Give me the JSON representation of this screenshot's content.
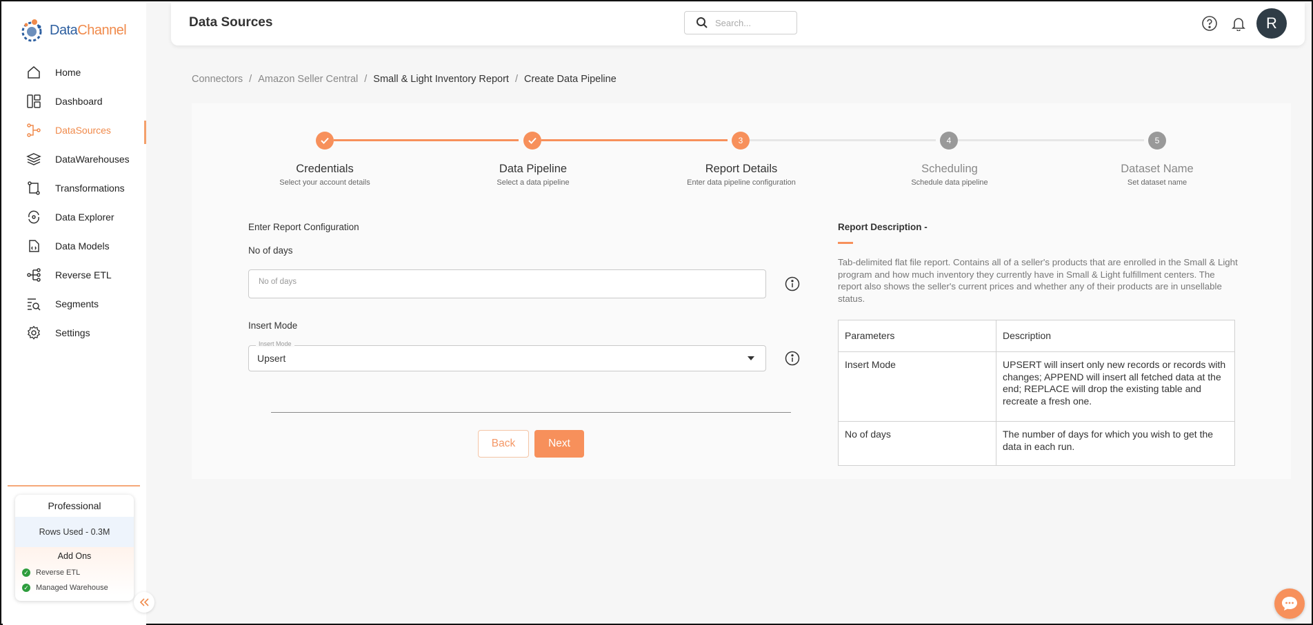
{
  "app": {
    "logo_text_a": "Data",
    "logo_text_b": "Channel",
    "accent_color": "#f7905b"
  },
  "sidebar": {
    "items": [
      {
        "label": "Home",
        "icon": "home-icon"
      },
      {
        "label": "Dashboard",
        "icon": "dashboard-icon"
      },
      {
        "label": "DataSources",
        "icon": "datasources-icon",
        "active": true
      },
      {
        "label": "DataWarehouses",
        "icon": "layers-icon"
      },
      {
        "label": "Transformations",
        "icon": "transform-icon"
      },
      {
        "label": "Data Explorer",
        "icon": "explorer-icon"
      },
      {
        "label": "Data Models",
        "icon": "data-models-icon"
      },
      {
        "label": "Reverse ETL",
        "icon": "reverse-etl-icon"
      },
      {
        "label": "Segments",
        "icon": "segments-icon"
      },
      {
        "label": "Settings",
        "icon": "gear-icon"
      }
    ],
    "plan": {
      "title": "Professional",
      "rows_used": "Rows Used - 0.3M",
      "addons_title": "Add Ons",
      "addons": [
        "Reverse ETL",
        "Managed Warehouse"
      ]
    }
  },
  "header": {
    "title": "Data Sources",
    "search_placeholder": "Search...",
    "avatar_initial": "R"
  },
  "breadcrumb": [
    "Connectors",
    "Amazon Seller Central",
    "Small & Light Inventory Report",
    "Create Data Pipeline"
  ],
  "stepper": [
    {
      "num": "",
      "title": "Credentials",
      "sub": "Select your account details",
      "state": "done"
    },
    {
      "num": "",
      "title": "Data Pipeline",
      "sub": "Select a data pipeline",
      "state": "done"
    },
    {
      "num": "3",
      "title": "Report Details",
      "sub": "Enter data pipeline configuration",
      "state": "current"
    },
    {
      "num": "4",
      "title": "Scheduling",
      "sub": "Schedule data pipeline",
      "state": "pending"
    },
    {
      "num": "5",
      "title": "Dataset Name",
      "sub": "Set dataset name",
      "state": "pending"
    }
  ],
  "form": {
    "section_title": "Enter Report Configuration",
    "days_label": "No of days",
    "days_placeholder": "No of days",
    "mode_label": "Insert Mode",
    "mode_legend": "Insert Mode",
    "mode_value": "Upsert",
    "back_label": "Back",
    "next_label": "Next"
  },
  "description": {
    "title": "Report Description -",
    "text": "Tab-delimited flat file report. Contains all of a seller's products that are enrolled in the Small & Light program and how much inventory they currently have in Small & Light fulfillment centers. The report also shows the seller's current prices and whether any of their products are in unsellable status.",
    "table": {
      "headers": [
        "Parameters",
        "Description"
      ],
      "rows": [
        [
          "Insert Mode",
          "UPSERT will insert only new records or records with changes; APPEND will insert all fetched data at the end; REPLACE will drop the existing table and recreate a fresh one."
        ],
        [
          "No of days",
          "The number of days for which you wish to get the data in each run."
        ]
      ]
    }
  }
}
